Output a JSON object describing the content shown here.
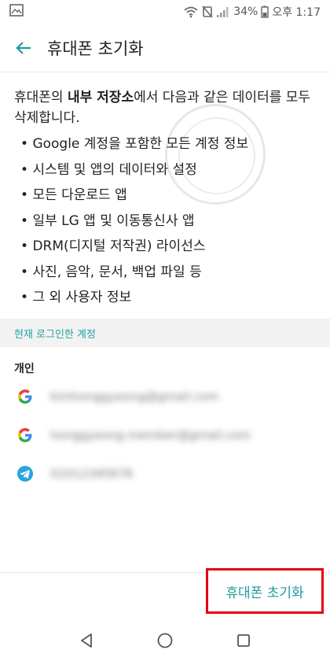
{
  "status_bar": {
    "battery": "34%",
    "time": "오후 1:17",
    "icons": [
      "gallery-icon",
      "wifi-icon",
      "silent-icon",
      "signal-icon",
      "battery-icon"
    ]
  },
  "app_bar": {
    "title": "휴대폰 초기화",
    "back_icon": "back-arrow-icon"
  },
  "intro": {
    "prefix": "휴대폰의 ",
    "bold": "내부 저장소",
    "suffix": "에서 다음과 같은 데이터를 모두 삭제합니다."
  },
  "bullets": [
    "Google 계정을 포함한 모든 계정 정보",
    "시스템 및 앱의 데이터와 설정",
    "모든 다운로드 앱",
    "일부 LG 앱 및 이동통신사 앱",
    "DRM(디지털 저작권) 라이선스",
    "사진, 음악, 문서, 백업 파일 등",
    "그 외 사용자 정보"
  ],
  "section_header": "현재 로그인한 계정",
  "group_label": "개인",
  "accounts": [
    {
      "icon": "google-icon",
      "text": "kimhonggyeong@gmail.com"
    },
    {
      "icon": "google-icon",
      "text": "honggyeong.member@gmail.com"
    },
    {
      "icon": "telegram-icon",
      "text": "01012345678"
    }
  ],
  "reset_button": "휴대폰 초기화",
  "nav": [
    "back-nav-icon",
    "home-nav-icon",
    "recents-nav-icon"
  ],
  "colors": {
    "accent": "#1a9aa0",
    "section_text": "#20a3a3",
    "highlight_border": "#e60012"
  }
}
